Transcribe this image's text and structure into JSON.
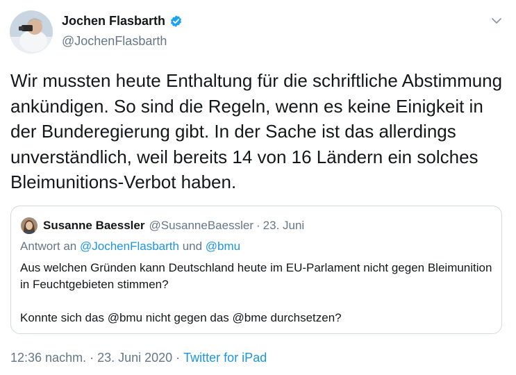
{
  "author": {
    "name": "Jochen Flasbarth",
    "handle": "@JochenFlasbarth"
  },
  "icons": {
    "verified": "verified-badge-icon",
    "menu": "chevron-down-icon"
  },
  "tweet": {
    "text": "Wir mussten heute Enthaltung für die schriftliche Abstimmung ankündigen. So sind die Regeln, wenn es keine Einigkeit in der Bunderegierung gibt. In der Sache ist das allerdings unverständlich, weil bereits 14 von 16 Ländern ein solches Bleimunitions-Verbot haben."
  },
  "quote": {
    "name": "Susanne Baessler",
    "handle": "@SusanneBaessler",
    "separator": "·",
    "date": "23. Juni",
    "reply_prefix": "Antwort an",
    "reply_to_1": "@JochenFlasbarth",
    "reply_and": "und",
    "reply_to_2": "@bmu",
    "paragraph_1": "Aus welchen Gründen kann Deutschland heute im EU-Parlament nicht gegen Bleimunition in Feuchtgebieten stimmen?",
    "paragraph_2": "Konnte sich das @bmu nicht gegen das @bme durchsetzen?"
  },
  "meta": {
    "time": "12:36 nachm.",
    "separator": "·",
    "date": "23. Juni 2020",
    "source": "Twitter for iPad"
  },
  "colors": {
    "text": "#14171a",
    "secondary": "#657786",
    "accent": "#1b95e0",
    "verified": "#1da1f2",
    "border": "#cfd9de"
  }
}
